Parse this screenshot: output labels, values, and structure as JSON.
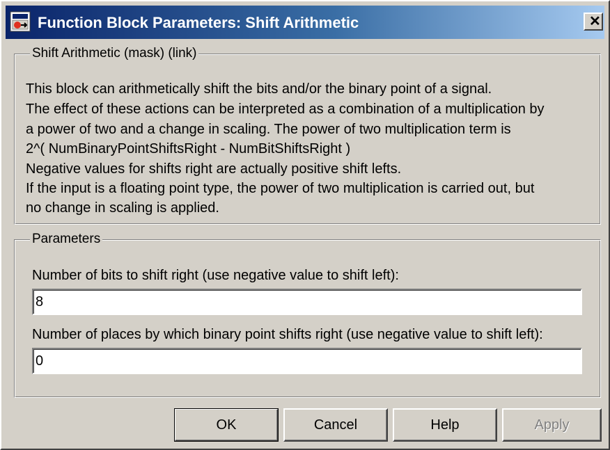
{
  "window": {
    "title": "Function Block Parameters: Shift Arithmetic",
    "close_label": "✕",
    "app_icon": "simulink-block-icon"
  },
  "description": {
    "legend": "Shift Arithmetic (mask) (link)",
    "lines": [
      "This block can arithmetically shift the bits and/or the binary point of a signal.",
      "The effect of these actions can be interpreted as a combination of a multiplication by",
      "a power of two and a change in scaling.  The power of two multiplication term is",
      "  2^( NumBinaryPointShiftsRight - NumBitShiftsRight )",
      "Negative values for shifts right are actually positive shift lefts.",
      "If the input is a floating point type, the power of two multiplication is carried out, but",
      "no change in scaling is applied."
    ]
  },
  "parameters": {
    "legend": "Parameters",
    "bits_label": "Number of bits to shift right (use negative value to shift left):",
    "bits_value": "8",
    "places_label": "Number of places by which binary point shifts right (use negative value to shift left):",
    "places_value": "0"
  },
  "buttons": {
    "ok": "OK",
    "cancel": "Cancel",
    "help": "Help",
    "apply": "Apply"
  }
}
